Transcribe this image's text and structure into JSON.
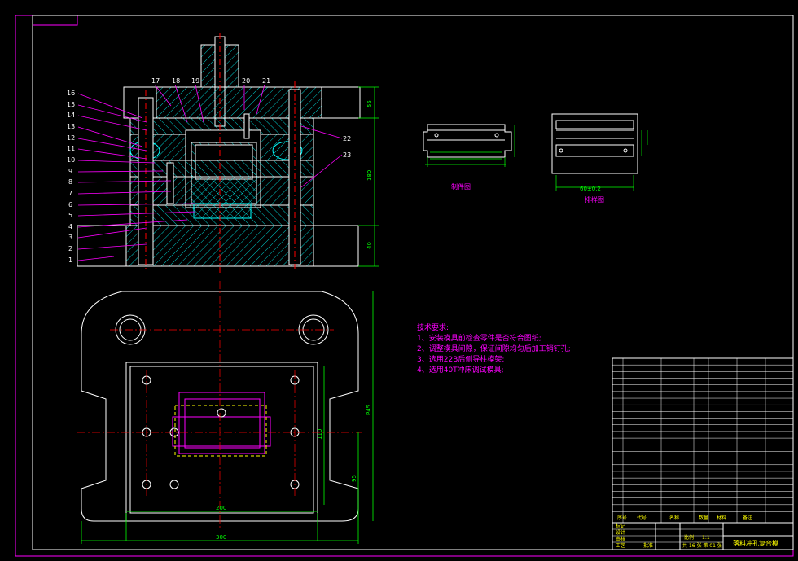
{
  "colors": {
    "background": "#000000",
    "frame": "#ff00ff",
    "outline": "#ffffff",
    "hatch": "#00ffff",
    "dimension": "#00ff00",
    "center": "#ff0000",
    "accent": "#ff00ff",
    "leader": "#ff00ff",
    "text_yellow": "#ffff00",
    "green_fill": "#00ff00"
  },
  "part_labels": {
    "left": [
      "16",
      "15",
      "14",
      "13",
      "12",
      "11",
      "10",
      "9",
      "8",
      "7",
      "6",
      "5",
      "4",
      "3",
      "2",
      "1"
    ],
    "top": [
      "17",
      "18",
      "19",
      "20",
      "21"
    ],
    "right": [
      "22",
      "23"
    ]
  },
  "dimensions": {
    "section_top": "55",
    "section_total": "180",
    "section_bottom": "40",
    "plan_width_inner": "200",
    "plan_width_outer": "300",
    "plan_height_right": "P45",
    "plan_height_mid": "110",
    "plan_height_low": "95",
    "part_width": "60±0.2"
  },
  "views": {
    "blank_view_title": "制件图",
    "layout_view_title": "排样图"
  },
  "tech_notes": {
    "title": "技术要求:",
    "items": [
      "1、安装模具前检查零件是否符合图纸;",
      "2、调整模具间隙，保证间隙均匀后加工销钉孔;",
      "3、选用22B后侧导柱模架;",
      "4、选用40T冲床调试模具;"
    ]
  },
  "title_block": {
    "drawing_name": "落料冲孔复合模",
    "scale_label": "比例",
    "scale_value": "1:1",
    "sheet_info": "共 16 张  第 01 张",
    "headers": [
      "序号",
      "代号",
      "名称",
      "数量",
      "材料",
      "备注"
    ],
    "sign_rows": [
      "标记",
      "设计",
      "审核",
      "工艺",
      "批准"
    ]
  }
}
